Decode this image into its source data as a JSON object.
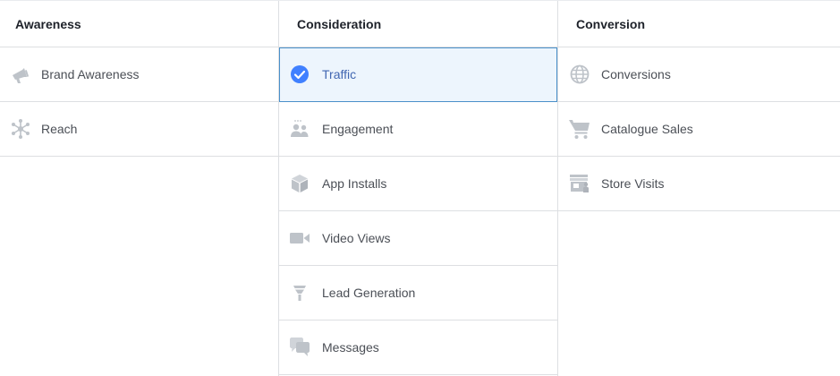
{
  "colors": {
    "icon_gray": "#bec3c9",
    "selected_blue": "#4080ff",
    "selected_bg": "#edf5fd",
    "selected_text": "#4267b2",
    "border": "#dddfe2"
  },
  "columns": {
    "awareness": {
      "header": "Awareness",
      "items": [
        {
          "label": "Brand Awareness",
          "icon": "megaphone-icon"
        },
        {
          "label": "Reach",
          "icon": "network-icon"
        }
      ]
    },
    "consideration": {
      "header": "Consideration",
      "items": [
        {
          "label": "Traffic",
          "icon": "check-circle-icon",
          "selected": true
        },
        {
          "label": "Engagement",
          "icon": "people-icon"
        },
        {
          "label": "App Installs",
          "icon": "box-icon"
        },
        {
          "label": "Video Views",
          "icon": "video-camera-icon"
        },
        {
          "label": "Lead Generation",
          "icon": "funnel-icon"
        },
        {
          "label": "Messages",
          "icon": "chat-bubbles-icon"
        }
      ]
    },
    "conversion": {
      "header": "Conversion",
      "items": [
        {
          "label": "Conversions",
          "icon": "globe-icon"
        },
        {
          "label": "Catalogue Sales",
          "icon": "shopping-cart-icon"
        },
        {
          "label": "Store Visits",
          "icon": "storefront-icon"
        }
      ]
    }
  }
}
